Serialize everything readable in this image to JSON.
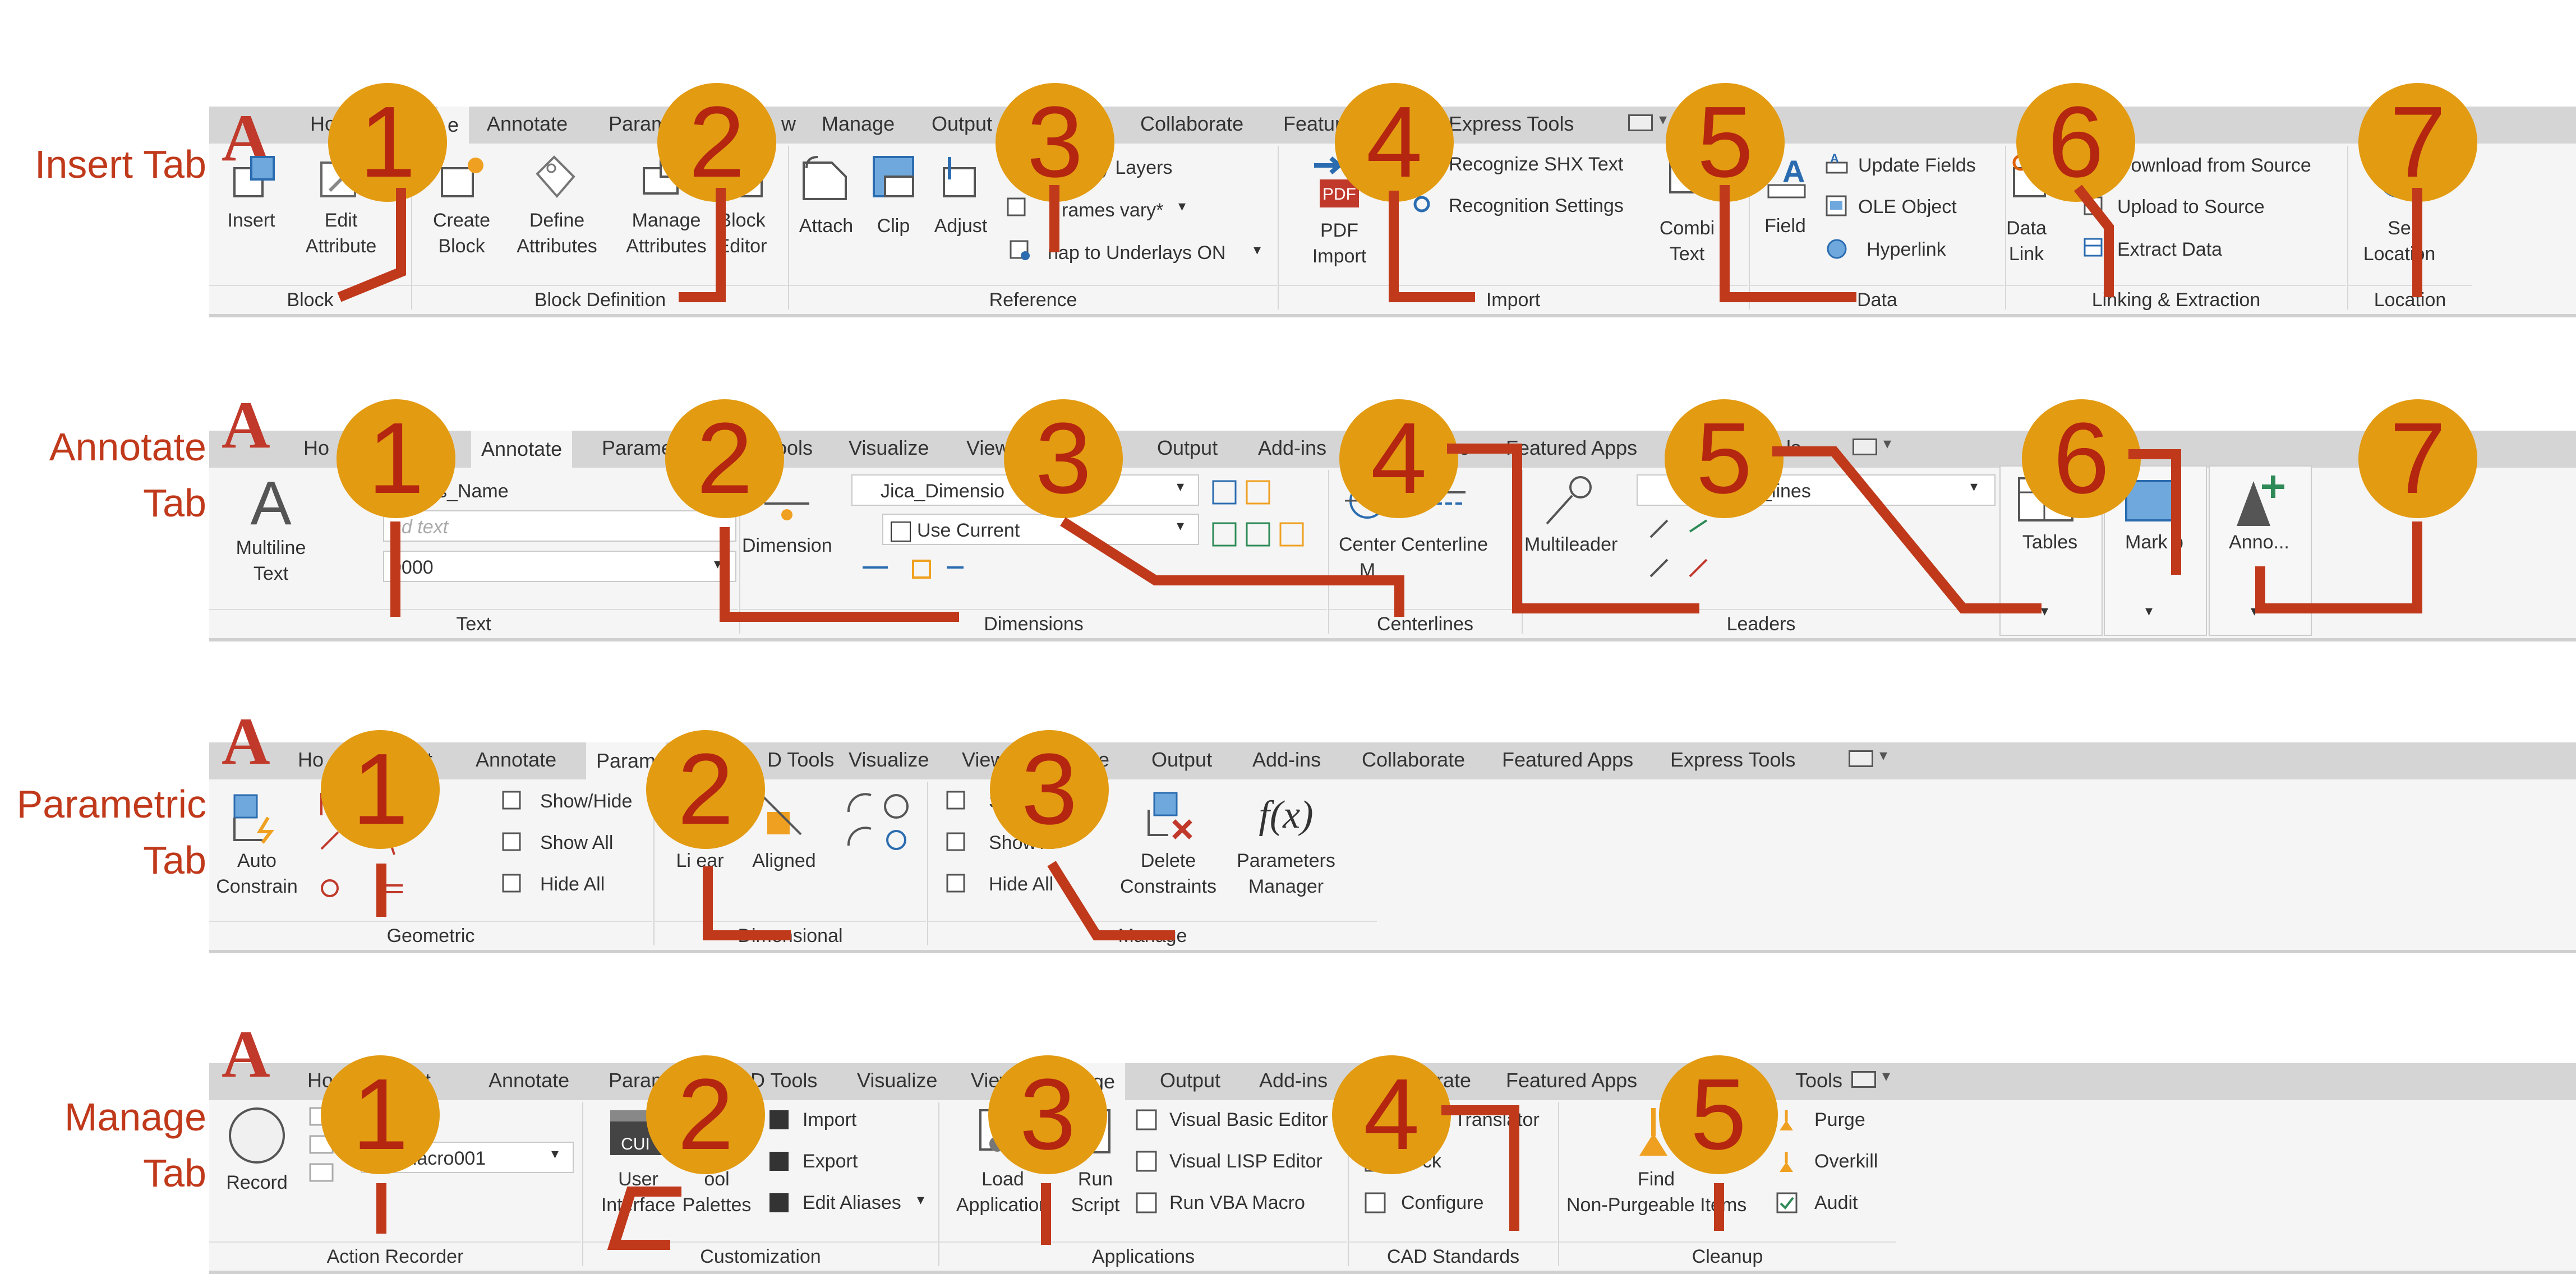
{
  "colors": {
    "accent": "#c0391b",
    "badge": "#e39b12",
    "badge_text": "#b4260f",
    "ribbon_bg": "#f5f5f5",
    "tabbar_bg": "#d5d5d5"
  },
  "insert": {
    "side_label": "Insert Tab",
    "tabs": [
      "Ho",
      "e",
      "Annotate",
      "Param",
      "w",
      "Manage",
      "Output",
      "Collaborate",
      "Featur",
      "Express Tools"
    ],
    "buttons": {
      "insert": "Insert",
      "edit_attribute": "Edit\nAttribute",
      "create_block": "Create\nBlock",
      "define_attributes": "Define\nAttributes",
      "manage_attributes": "Manage\nAttributes",
      "block_editor": "Block\nEditor",
      "attach": "Attach",
      "clip": "Clip",
      "adjust": "Adjust",
      "underlay_layers": "ay Layers",
      "frames_vary": "rames vary*",
      "snap_underlays": "nap to Underlays ON",
      "pdf_import": "PDF\nImport",
      "pdf_text": "PDF",
      "recognize_shx": "Recognize SHX Text",
      "recognition_settings": "Recognition Settings",
      "combine_text": "Combi\nText",
      "field": "Field",
      "update_fields": "Update Fields",
      "ole_object": "OLE Object",
      "hyperlink": "Hyperlink",
      "data_link": "Data\nLink",
      "download_source": "Download from Source",
      "upload_source": "Upload to Source",
      "extract_data": "Extract  Data",
      "set_location": "Se\nLocation"
    },
    "panels": [
      "Block",
      "Block Definition",
      "Reference",
      "Import",
      "Data",
      "Linking & Extraction",
      "Location"
    ]
  },
  "annotate": {
    "side_label_1": "Annotate",
    "side_label_2": "Tab",
    "tabs": [
      "Ho",
      "Annotate",
      "Parame",
      "ools",
      "Visualize",
      "View",
      "Output",
      "Add-ins",
      "e",
      "Featured Apps",
      "ls"
    ],
    "buttons": {
      "multiline_text": "Multiline\nText",
      "text_style": "a_Axis_Name",
      "find_text": "nd text",
      "text_height": "0000",
      "dimension": "Dimension",
      "dim_style": "Jica_Dimensio",
      "use_current": "Use Current",
      "center_mark": "Center\nM",
      "centerline": "Centerline",
      "multileader": "Multileader",
      "leader_style": "_lines",
      "tables": "Tables",
      "markup": "Mark p",
      "anno": "Anno..."
    },
    "panels": [
      "Text",
      "Dimensions",
      "Centerlines",
      "Leaders"
    ]
  },
  "parametric": {
    "side_label_1": "Parametric",
    "side_label_2": "Tab",
    "tabs": [
      "Ho",
      "t",
      "Annotate",
      "Param",
      "D Tools",
      "Visualize",
      "View",
      "e",
      "Output",
      "Add-ins",
      "Collaborate",
      "Featured Apps",
      "Express Tools"
    ],
    "buttons": {
      "auto_constrain": "Auto\nConstrain",
      "show_hide": "Show/Hide",
      "show_all": "Show All",
      "hide_all": "Hide All",
      "linear": "Li ear",
      "aligned": "Aligned",
      "show_m": "S",
      "show_all_m": "Show A",
      "hide_all_m": "Hide All",
      "delete_constraints": "Delete\nConstraints",
      "parameters_manager": "Parameters\nManager",
      "fx": "f(x)"
    },
    "panels": [
      "Geometric",
      "Dimensional",
      "Manage"
    ]
  },
  "manage": {
    "side_label_1": "Manage",
    "side_label_2": "Tab",
    "tabs": [
      "Ho",
      "sert",
      "Annotate",
      "Param",
      "3D Tools",
      "Visualize",
      "View",
      "age",
      "Output",
      "Add-ins",
      "orate",
      "Featured Apps",
      "E",
      "Tools"
    ],
    "buttons": {
      "record": "Record",
      "macro": "macro001",
      "user_interface": "User\nInterface",
      "tool_palettes": "ool\nPalettes",
      "cui": "CUI",
      "import": "Import",
      "export": "Export",
      "edit_aliases": "Edit Aliases",
      "load_application": "Load\nApplication",
      "run_script": "Run\nScript",
      "vba_editor": "Visual Basic Editor",
      "lisp_editor": "Visual LISP Editor",
      "run_vba": "Run VBA Macro",
      "translator": "Translator",
      "check": "heck",
      "configure": "Configure",
      "find_non_purgeable": "Find\nNon-Purgeable Items",
      "purge": "Purge",
      "overkill": "Overkill",
      "audit": "Audit"
    },
    "panels": [
      "Action Recorder",
      "Customization",
      "Applications",
      "CAD Standards",
      "Cleanup"
    ]
  },
  "badges": {
    "one": "1",
    "two": "2",
    "three": "3",
    "four": "4",
    "five": "5",
    "six": "6",
    "seven": "7"
  }
}
